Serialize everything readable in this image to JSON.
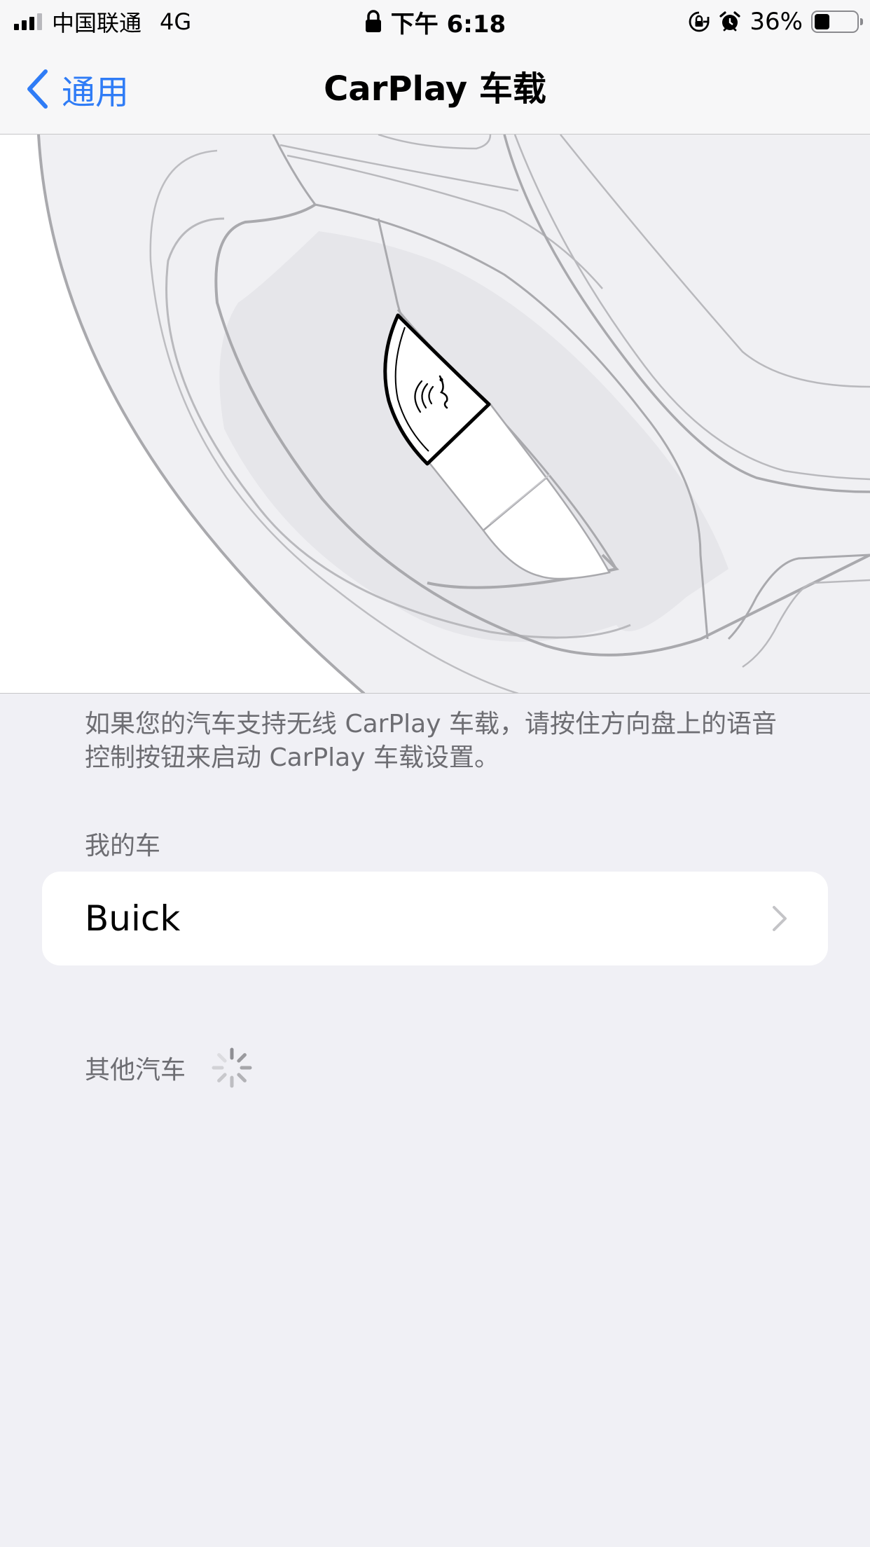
{
  "status_bar": {
    "carrier": "中国联通",
    "network": "4G",
    "time": "下午 6:18",
    "battery_percent": "36%",
    "battery_level": 0.36,
    "signal_bars_active": 3,
    "icons": [
      "signal-icon",
      "lock-icon",
      "rotation-lock-icon",
      "alarm-icon",
      "battery-icon"
    ]
  },
  "nav": {
    "back_label": "通用",
    "title": "CarPlay 车载"
  },
  "illustration": {
    "icon": "steering-wheel-voice-button-illustration"
  },
  "description": "如果您的汽车支持无线 CarPlay 车载，请按住方向盘上的语音控制按钮来启动 CarPlay 车载设置。",
  "my_cars": {
    "header": "我的车",
    "items": [
      {
        "name": "Buick"
      }
    ]
  },
  "other_cars": {
    "header": "其他汽车",
    "loading_icon": "spinner-icon"
  },
  "colors": {
    "accent": "#2f7cf6",
    "background": "#f0f0f5",
    "secondary_text": "#6d6d72"
  }
}
